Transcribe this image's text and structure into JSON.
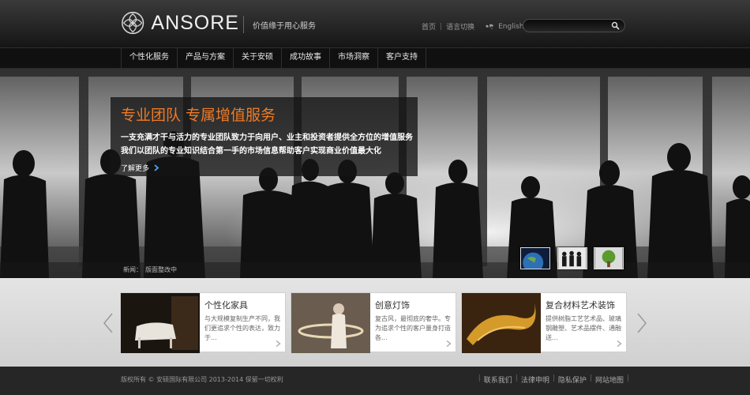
{
  "header": {
    "brand": "ANSORE",
    "slogan": "价值缘于用心服务",
    "home_link": "首页",
    "language_link": "语言切换",
    "english_link": "English",
    "search_placeholder": ""
  },
  "nav": {
    "items": [
      "个性化服务",
      "产品与方案",
      "关于安硕",
      "成功故事",
      "市场洞察",
      "客户支持"
    ]
  },
  "banner": {
    "title": "专业团队 专属增值服务",
    "line1": "一支充满才干与活力的专业团队致力于向用户、业主和投资者提供全方位的增值服务",
    "line2": "我们以团队的专业知识结合第一手的市场信息帮助客户实现商业价值最大化",
    "more": "了解更多",
    "news_label": "新闻：",
    "news_text": "版面整改中",
    "accent_color": "#f07a25"
  },
  "products": {
    "cards": [
      {
        "title": "个性化家具",
        "desc": "与大规模复制生产不同，我们更追求个性的表达，致力于..."
      },
      {
        "title": "创意灯饰",
        "desc": "复古风，最彻底的奢华。专为追求个性的客户量身打造各..."
      },
      {
        "title": "复合材料艺术装饰",
        "desc": "提供树脂工艺艺术品、玻璃钢雕塑、艺术品摆件、通融送..."
      }
    ]
  },
  "footer": {
    "copyright": "版权所有 © 安硕国际有限公司 2013-2014 保留一切权利",
    "links": [
      "联系我们",
      "法律申明",
      "隐私保护",
      "网站地图"
    ]
  }
}
